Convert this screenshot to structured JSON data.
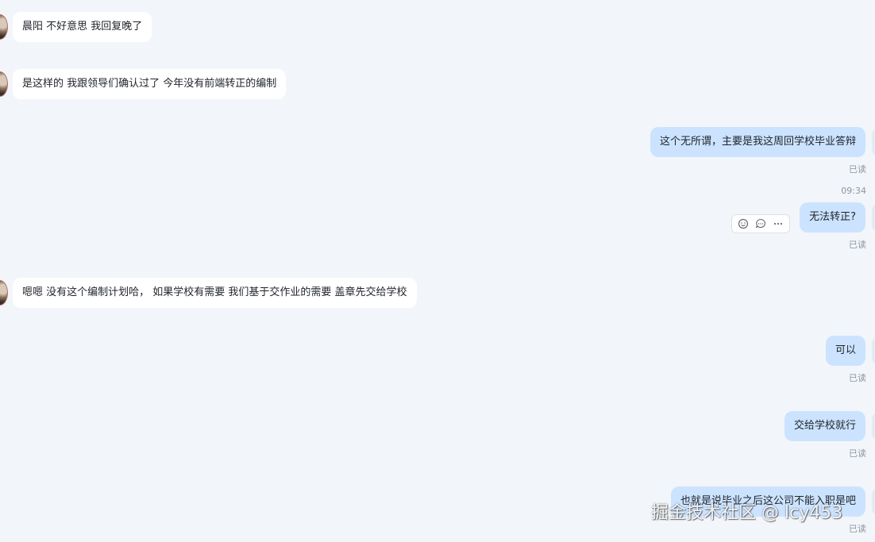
{
  "messages": [
    {
      "id": "m1",
      "direction": "incoming",
      "text": "晨阳 不好意思 我回复晚了"
    },
    {
      "id": "m2",
      "direction": "incoming",
      "text": "是这样的 我跟领导们确认过了 今年没有前端转正的编制"
    },
    {
      "id": "m3",
      "direction": "outgoing",
      "text": "这个无所谓，主要是我这周回学校毕业答辩",
      "status": "已读"
    },
    {
      "id": "ts1",
      "type": "timestamp",
      "text": "09:34"
    },
    {
      "id": "m4",
      "direction": "outgoing",
      "text": "无法转正?",
      "status": "已读"
    },
    {
      "id": "m5",
      "direction": "incoming",
      "text": "嗯嗯 没有这个编制计划哈， 如果学校有需要 我们基于交作业的需要 盖章先交给学校"
    },
    {
      "id": "m6",
      "direction": "outgoing",
      "text": "可以",
      "status": "已读"
    },
    {
      "id": "m7",
      "direction": "outgoing",
      "text": "交给学校就行",
      "status": "已读"
    },
    {
      "id": "m8",
      "direction": "outgoing",
      "text": "也就是说毕业之后这公司不能入职是吧",
      "status": "已读"
    }
  ],
  "hover_toolbar": {
    "icons": [
      "reaction-icon",
      "reply-icon",
      "more-icon"
    ]
  },
  "watermark": "掘金技术社区 @ lcy453",
  "colors": {
    "background": "#f2f6fa",
    "incoming_bubble": "#ffffff",
    "outgoing_bubble": "#cce3ff",
    "text": "#1f2329",
    "meta_text": "#8f959e"
  }
}
